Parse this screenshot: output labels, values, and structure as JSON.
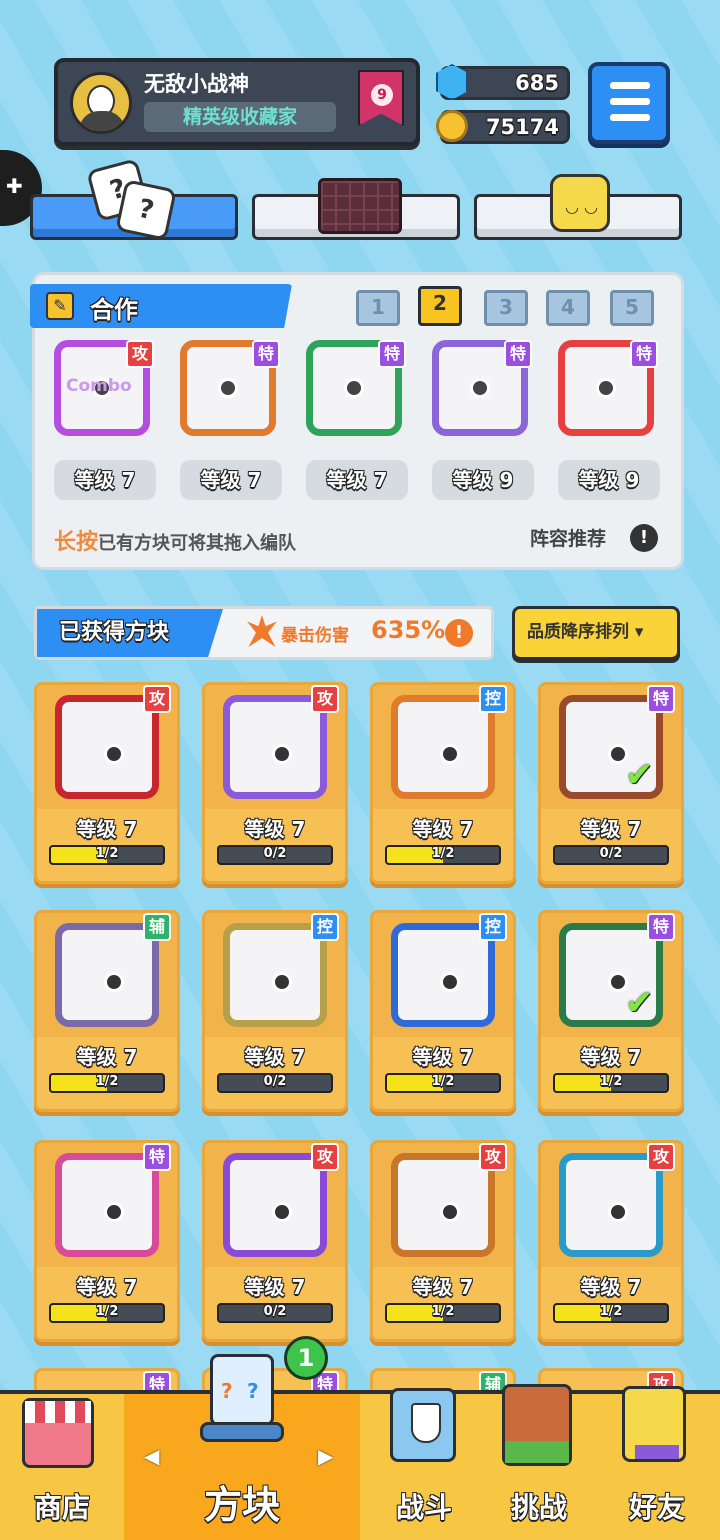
{
  "profile": {
    "name": "无敌小战神",
    "title": "精英级收藏家",
    "rank": "9"
  },
  "currency": {
    "gems": "685",
    "coins": "75174"
  },
  "top_tabs": [
    "dice-icon",
    "chocolate-block-icon",
    "smiley-block-icon"
  ],
  "deck": {
    "section_label": "合作",
    "pages": [
      "1",
      "2",
      "3",
      "4",
      "5"
    ],
    "selected_page": "2",
    "cards": [
      {
        "tag": "攻",
        "frame": "#b54ee0",
        "inner": "Combo",
        "level": "等级 7"
      },
      {
        "tag": "特",
        "frame": "#e07a2c",
        "inner": "",
        "level": "等级 7"
      },
      {
        "tag": "特",
        "frame": "#2fa35a",
        "inner": "",
        "level": "等级 7"
      },
      {
        "tag": "特",
        "frame": "#8a66d8",
        "inner": "",
        "level": "等级 9"
      },
      {
        "tag": "特",
        "frame": "#e64040",
        "inner": "",
        "level": "等级 9"
      }
    ],
    "hint_emph": "长按",
    "hint_rest": "已有方块可将其拖入编队",
    "recommend": "阵容推荐",
    "recommend_icon": "!"
  },
  "obtained": {
    "label": "已获得方块",
    "crit_label": "暴击伤害",
    "crit_value": "635%",
    "crit_info": "!",
    "sort_label": "品质降序排列 ▾"
  },
  "grid": [
    {
      "tag": "攻",
      "tagtype": "atk",
      "frame": "#c8262f",
      "level": "等级 7",
      "progress": "1/2",
      "fill": 0.5,
      "check": false
    },
    {
      "tag": "攻",
      "tagtype": "atk",
      "frame": "#8a5ad8",
      "level": "等级 7",
      "progress": "0/2",
      "fill": 0,
      "check": false
    },
    {
      "tag": "控",
      "tagtype": "ctl",
      "frame": "#e07a2c",
      "level": "等级 7",
      "progress": "1/2",
      "fill": 0.5,
      "check": false
    },
    {
      "tag": "特",
      "tagtype": "spc",
      "frame": "#9a4a2a",
      "level": "等级 7",
      "progress": "0/2",
      "fill": 0,
      "check": true
    },
    {
      "tag": "辅",
      "tagtype": "sup",
      "frame": "#7a6aa8",
      "level": "等级 7",
      "progress": "1/2",
      "fill": 0.5,
      "check": false
    },
    {
      "tag": "控",
      "tagtype": "ctl",
      "frame": "#b8a04a",
      "level": "等级 7",
      "progress": "0/2",
      "fill": 0,
      "check": false
    },
    {
      "tag": "控",
      "tagtype": "ctl",
      "frame": "#2f6ad8",
      "level": "等级 7",
      "progress": "1/2",
      "fill": 0.5,
      "check": false
    },
    {
      "tag": "特",
      "tagtype": "spc",
      "frame": "#2a7a4a",
      "level": "等级 7",
      "progress": "1/2",
      "fill": 0.5,
      "check": true
    },
    {
      "tag": "特",
      "tagtype": "spc",
      "frame": "#d84a9a",
      "level": "等级 7",
      "progress": "1/2",
      "fill": 0.5,
      "check": false
    },
    {
      "tag": "攻",
      "tagtype": "atk",
      "frame": "#8a4ad8",
      "level": "等级 7",
      "progress": "0/2",
      "fill": 0,
      "check": false
    },
    {
      "tag": "攻",
      "tagtype": "atk",
      "frame": "#c8762a",
      "level": "等级 7",
      "progress": "1/2",
      "fill": 0.5,
      "check": false
    },
    {
      "tag": "攻",
      "tagtype": "atk",
      "frame": "#2a9ac8",
      "level": "等级 7",
      "progress": "1/2",
      "fill": 0.5,
      "check": false
    }
  ],
  "partial_row_tags": [
    {
      "tag": "特",
      "tagtype": "spc"
    },
    {
      "tag": "特",
      "tagtype": "spc"
    },
    {
      "tag": "辅",
      "tagtype": "sup"
    },
    {
      "tag": "攻",
      "tagtype": "atk"
    }
  ],
  "nav": {
    "shop": "商店",
    "blocks": "方块",
    "blocks_badge": "1",
    "battle": "战斗",
    "challenge": "挑战",
    "friends": "好友",
    "arrow_left": "◀",
    "arrow_right": "▶"
  }
}
